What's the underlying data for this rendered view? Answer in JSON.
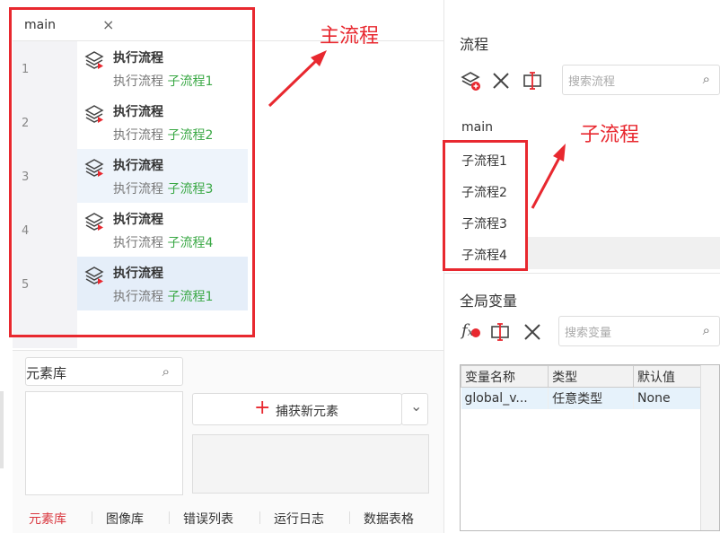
{
  "editor": {
    "tab_label": "main",
    "tab_close": "×",
    "rows": [
      {
        "line": "1",
        "title": "执行流程",
        "prefix": "执行流程",
        "sub": "子流程1"
      },
      {
        "line": "2",
        "title": "执行流程",
        "prefix": "执行流程",
        "sub": "子流程2"
      },
      {
        "line": "3",
        "title": "执行流程",
        "prefix": "执行流程",
        "sub": "子流程3"
      },
      {
        "line": "4",
        "title": "执行流程",
        "prefix": "执行流程",
        "sub": "子流程4"
      },
      {
        "line": "5",
        "title": "执行流程",
        "prefix": "执行流程",
        "sub": "子流程1"
      }
    ]
  },
  "annotations": {
    "main_flow": "主流程",
    "sub_flow": "子流程"
  },
  "element_lib": {
    "search_placeholder": "元素库",
    "capture_button": "捕获新元素",
    "capture_plus": "+",
    "dropdown_chevron": "⌄"
  },
  "bottom_tabs": [
    {
      "label": "元素库",
      "active": true
    },
    {
      "label": "图像库",
      "active": false
    },
    {
      "label": "错误列表",
      "active": false
    },
    {
      "label": "运行日志",
      "active": false
    },
    {
      "label": "数据表格",
      "active": false
    }
  ],
  "flows": {
    "title": "流程",
    "search_placeholder": "搜索流程",
    "items": [
      "main",
      "子流程1",
      "子流程2",
      "子流程3",
      "子流程4"
    ]
  },
  "globals": {
    "title": "全局变量",
    "search_placeholder": "搜索变量",
    "columns": [
      "变量名称",
      "类型",
      "默认值"
    ],
    "rows": [
      {
        "name": "global_v...",
        "type": "任意类型",
        "default": "None"
      }
    ]
  },
  "colors": {
    "accent_red": "#e8282f",
    "sub_green": "#3aa845"
  }
}
